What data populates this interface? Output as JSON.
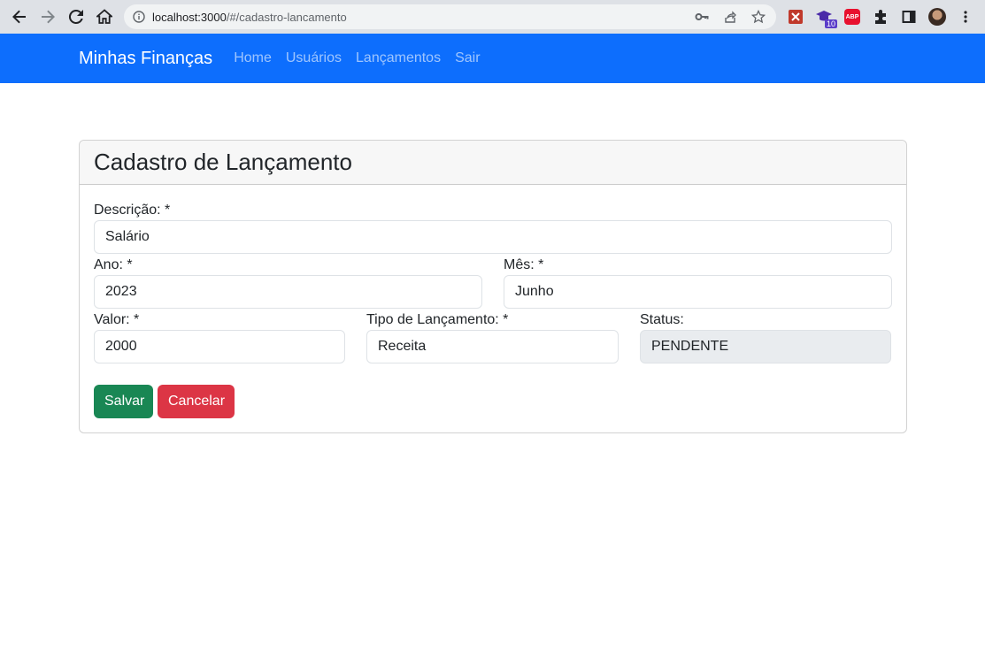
{
  "browser": {
    "url_host": "localhost:3000",
    "url_path": "/#/cadastro-lancamento",
    "extension_badge": "10",
    "abp_label": "ABP"
  },
  "navbar": {
    "brand": "Minhas Finanças",
    "links": [
      "Home",
      "Usuários",
      "Lançamentos",
      "Sair"
    ],
    "color": "#0d6efd"
  },
  "card": {
    "title": "Cadastro de Lançamento"
  },
  "form": {
    "descricao": {
      "label": "Descrição: *",
      "value": "Salário"
    },
    "ano": {
      "label": "Ano: *",
      "value": "2023"
    },
    "mes": {
      "label": "Mês: *",
      "value": "Junho"
    },
    "valor": {
      "label": "Valor: *",
      "value": "2000"
    },
    "tipo": {
      "label": "Tipo de Lançamento: *",
      "value": "Receita"
    },
    "status": {
      "label": "Status:",
      "value": "PENDENTE"
    }
  },
  "buttons": {
    "save": "Salvar",
    "cancel": "Cancelar"
  }
}
